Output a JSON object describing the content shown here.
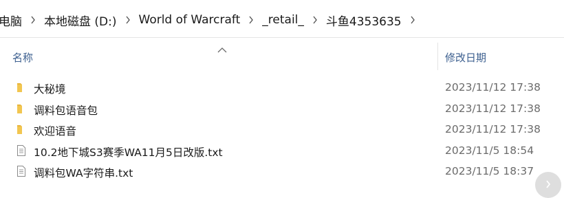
{
  "breadcrumb": {
    "items": [
      {
        "label": "电脑"
      },
      {
        "label": "本地磁盘 (D:)"
      },
      {
        "label": "World of Warcraft"
      },
      {
        "label": "_retail_"
      },
      {
        "label": "斗鱼4353635"
      }
    ]
  },
  "columns": {
    "name": "名称",
    "date_modified": "修改日期"
  },
  "files": [
    {
      "name": "大秘境",
      "date": "2023/11/12 17:38",
      "icon": "folder-icon"
    },
    {
      "name": "调料包语音包",
      "date": "2023/11/12 17:38",
      "icon": "folder-icon"
    },
    {
      "name": "欢迎语音",
      "date": "2023/11/12 17:38",
      "icon": "folder-icon"
    },
    {
      "name": "10.2地下城S3赛季WA11月5日改版.txt",
      "date": "2023/11/5 18:54",
      "icon": "text-file-icon"
    },
    {
      "name": "调料包WA字符串.txt",
      "date": "2023/11/5 18:37",
      "icon": "text-file-icon"
    }
  ],
  "colors": {
    "folder": "#e8b53c",
    "header_text": "#3c5f8f",
    "date_text": "#6b6b6b"
  }
}
